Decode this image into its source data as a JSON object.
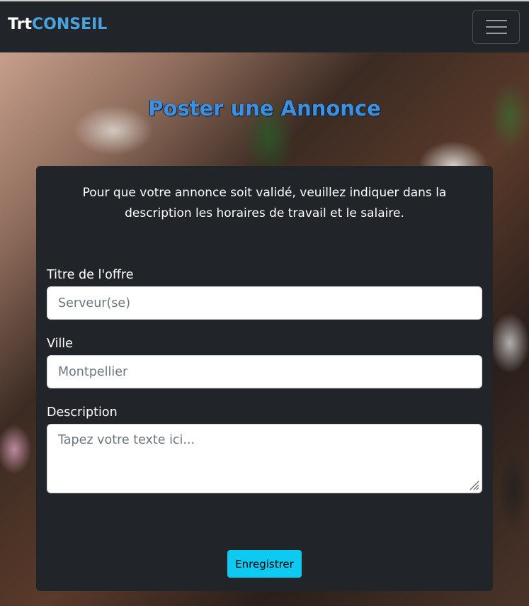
{
  "navbar": {
    "brand_part1": "Trt",
    "brand_part2": "CONSEIL",
    "toggler_icon": "hamburger-menu-icon"
  },
  "page": {
    "title": "Poster une Annonce"
  },
  "form": {
    "intro": "Pour que votre annonce soit validé, veuillez indiquer dans la description les horaires de travail et le salaire.",
    "title_label": "Titre de l'offre",
    "title_placeholder": "Serveur(se)",
    "city_label": "Ville",
    "city_placeholder": "Montpellier",
    "description_label": "Description",
    "description_placeholder": "Tapez votre texte ici...",
    "submit_label": "Enregistrer"
  },
  "colors": {
    "navbar_bg": "#212529",
    "brand_accent": "#4aa3df",
    "title_color": "#3d8fe0",
    "card_bg": "#212529",
    "button_bg": "#0dcaf0"
  }
}
